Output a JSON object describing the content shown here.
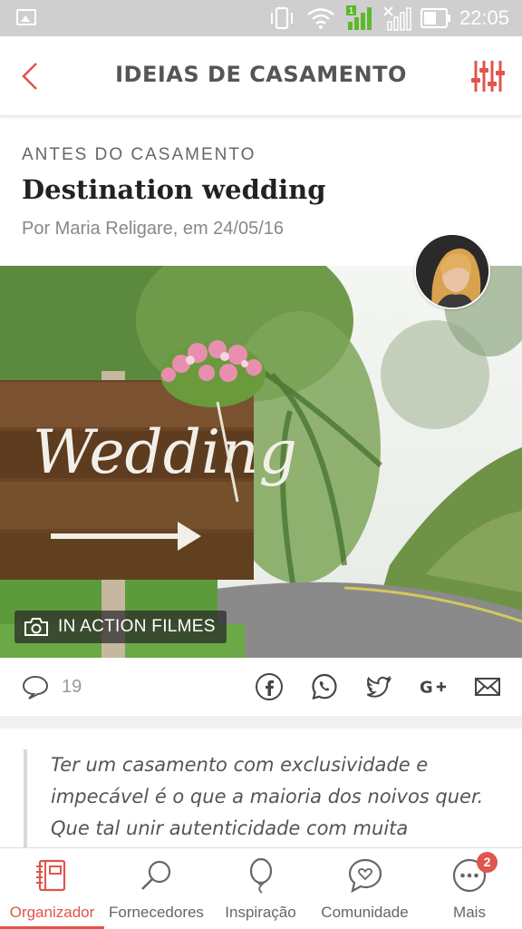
{
  "status_bar": {
    "time": "22:05",
    "signal_badge": "1"
  },
  "app_bar": {
    "title": "IDEIAS DE CASAMENTO"
  },
  "article": {
    "category": "ANTES DO CASAMENTO",
    "title": "Destination wedding",
    "byline": "Por Maria Religare, em 24/05/16",
    "photo_credit": "IN ACTION FILMES",
    "sign_text": "Wedding",
    "comment_count": "19",
    "excerpt": "Ter um casamento com exclusividade e impecável é o que a maioria dos noivos quer. Que tal unir autenticidade com muita"
  },
  "share_icons": [
    "facebook-icon",
    "whatsapp-icon",
    "twitter-icon",
    "google-plus-icon",
    "email-icon"
  ],
  "bottom_nav": {
    "items": [
      {
        "label": "Organizador",
        "icon": "planner-icon",
        "active": true
      },
      {
        "label": "Fornecedores",
        "icon": "search-icon",
        "active": false
      },
      {
        "label": "Inspiração",
        "icon": "balloon-icon",
        "active": false
      },
      {
        "label": "Comunidade",
        "icon": "heart-chat-icon",
        "active": false
      },
      {
        "label": "Mais",
        "icon": "more-icon",
        "active": false
      }
    ],
    "mais_badge": "2"
  },
  "colors": {
    "accent": "#e0554d",
    "status_bar": "#cfcfcf",
    "signal_green": "#5db82d"
  }
}
